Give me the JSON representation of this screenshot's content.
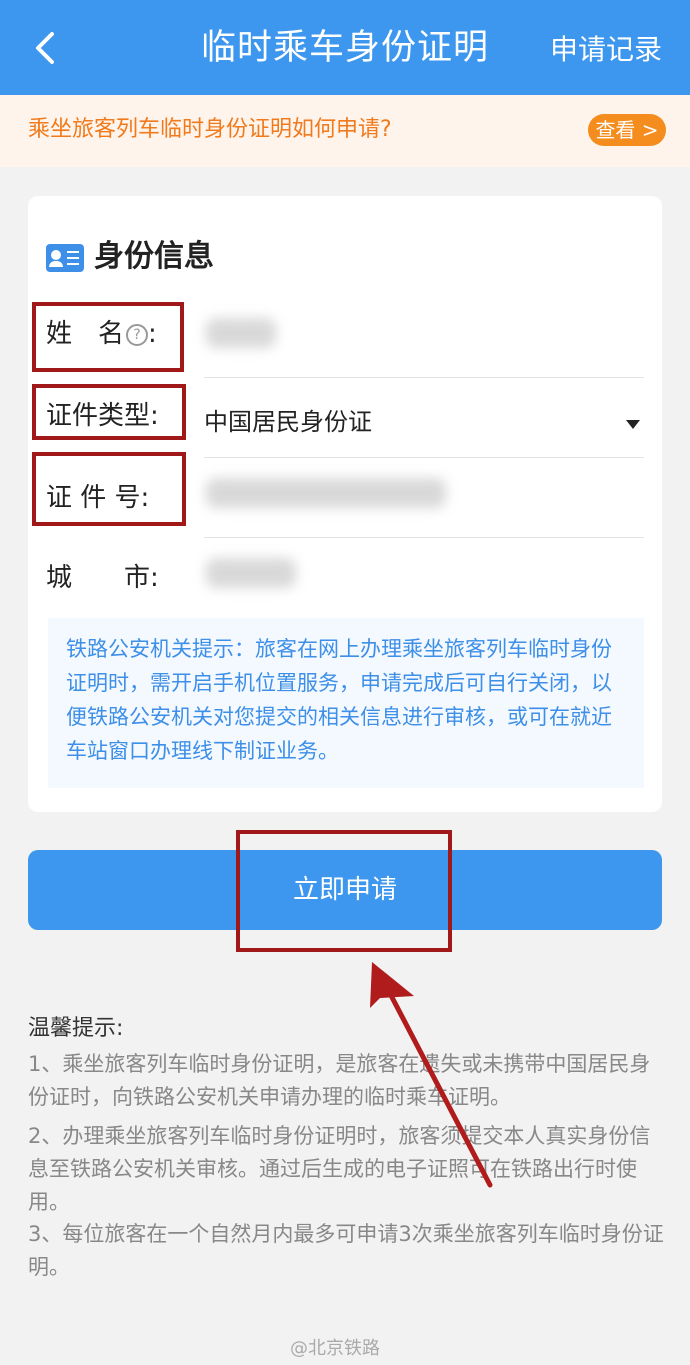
{
  "header": {
    "back_icon": "chevron-left-icon",
    "title": "临时乘车身份证明",
    "right_link": "申请记录"
  },
  "notice": {
    "text": "乘坐旅客列车临时身份证明如何申请?",
    "button": "查看 >"
  },
  "card": {
    "title": "身份信息",
    "fields": {
      "name_label": "姓　名",
      "name_colon": ":",
      "id_type_label": "证件类型:",
      "id_type_value": "中国居民身份证",
      "id_number_label": "证 件 号:",
      "city_label": "城　　市:"
    },
    "tip": "铁路公安机关提示：旅客在网上办理乘坐旅客列车临时身份证明时，需开启手机位置服务，申请完成后可自行关闭，以便铁路公安机关对您提交的相关信息进行审核，或可在就近车站窗口办理线下制证业务。"
  },
  "submit": {
    "label": "立即申请"
  },
  "warm_tips": {
    "title": "温馨提示:",
    "items": [
      "1、乘坐旅客列车临时身份证明，是旅客在遗失或未携带中国居民身份证时，向铁路公安机关申请办理的临时乘车证明。",
      "2、办理乘坐旅客列车临时身份证明时，旅客须提交本人真实身份信息至铁路公安机关审核。通过后生成的电子证照可在铁路出行时使用。",
      "3、每位旅客在一个自然月内最多可申请3次乘坐旅客列车临时身份证明。"
    ]
  },
  "watermark": "@北京铁路",
  "colors": {
    "header_bg": "#3d97ee",
    "notice_text": "#f07a1c",
    "notice_button": "#f58c1e",
    "tip_text": "#3d8fe8",
    "highlight_box": "#a01818",
    "arrow": "#b01c1c"
  }
}
